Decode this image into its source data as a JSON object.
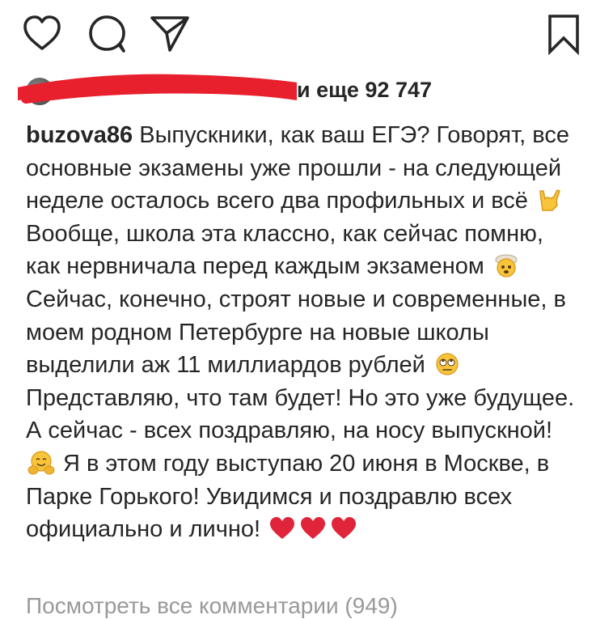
{
  "actions": {
    "like_icon": "heart-outline",
    "comment_icon": "speech-bubble",
    "share_icon": "paper-plane",
    "save_icon": "bookmark"
  },
  "likes": {
    "text": "и еще 92 747"
  },
  "caption": {
    "username": "buzova86",
    "seg1": " Выпускники, как ваш ЕГЭ? Говорят, все основные экзамены уже прошли - на следующей неделе осталось всего два профильных и всё",
    "seg2": " Вообще, школа эта классно, как сейчас помню, как нервничала перед каждым экзаменом",
    "seg3": " Сейчас, конечно, строят новые и современные, в моем родном Петербурге на новые школы выделили аж 11 миллиардов рублей",
    "seg4": " Представляю, что там будет! Но это уже будущее. А сейчас - всех поздравляю, на носу выпускной!",
    "seg5": " Я в этом году выступаю 20 июня в Москве, в Парке Горького! Увидимся и поздравлю всех официально и лично!",
    "emojis": [
      "rock-on-hand",
      "exploding-head",
      "eye-roll-face",
      "hugging-face",
      "red-heart",
      "red-heart",
      "red-heart"
    ]
  },
  "comments": {
    "view_all": "Посмотреть все комментарии (949)"
  },
  "colors": {
    "text": "#262626",
    "muted": "#999999",
    "scribble": "#e8202e",
    "heart": "#e0243a"
  }
}
